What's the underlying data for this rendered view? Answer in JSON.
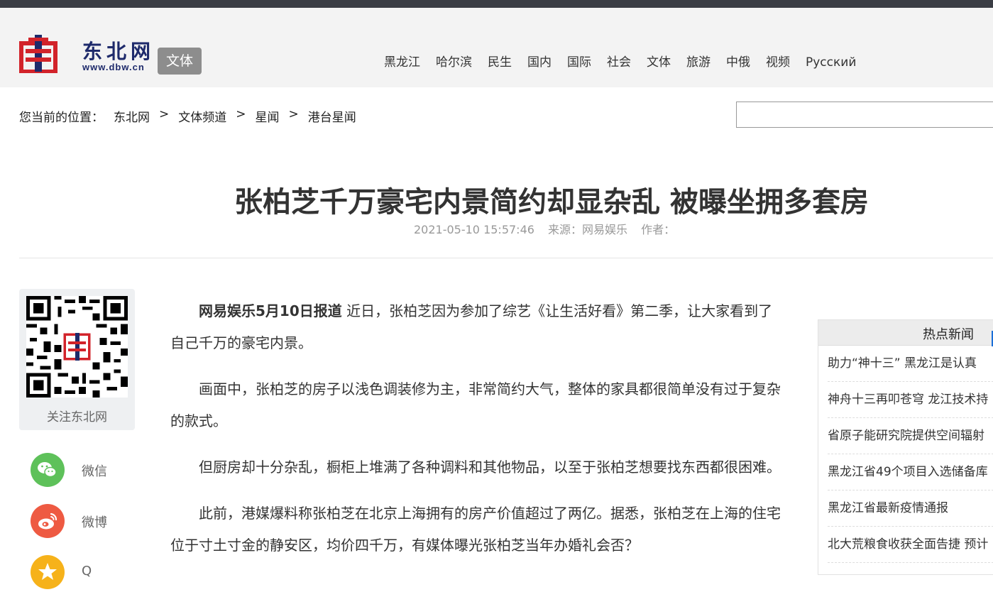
{
  "header": {
    "logo_text": "东北网",
    "logo_url": "www.dbw.cn",
    "channel_badge": "文体",
    "nav": [
      "黑龙江",
      "哈尔滨",
      "民生",
      "国内",
      "国际",
      "社会",
      "文体",
      "旅游",
      "中俄",
      "视频",
      "Русский"
    ]
  },
  "breadcrumb": {
    "prefix": "您当前的位置：",
    "items": [
      "东北网",
      "文体频道",
      "星闻",
      "港台星闻"
    ],
    "separator": ">"
  },
  "search": {
    "value": "",
    "placeholder": ""
  },
  "article": {
    "title": "张柏芝千万豪宅内景简约却显杂乱 被曝坐拥多套房",
    "datetime": "2021-05-10 15:57:46",
    "source": "来源：网易娱乐",
    "author": "作者：",
    "lead_bold": "网易娱乐5月10日报道",
    "p1_rest": " 近日，张柏芝因为参加了综艺《让生活好看》第二季，让大家看到了自己千万的豪宅内景。",
    "p2": "画面中，张柏芝的房子以浅色调装修为主，非常简约大气，整体的家具都很简单没有过于复杂的款式。",
    "p3": "但厨房却十分杂乱，橱柜上堆满了各种调料和其他物品，以至于张柏芝想要找东西都很困难。",
    "p4": "此前，港媒爆料称张柏芝在北京上海拥有的房产价值超过了两亿。据悉，张柏芝在上海的住宅位于寸土寸金的静安区，均价四千万，有媒体曝光张柏芝当年办婚礼会否？"
  },
  "share": {
    "qr_caption": "关注东北网",
    "wechat": "微信",
    "weibo": "微博",
    "third": "Q"
  },
  "hot_news": {
    "title": "热点新闻",
    "items": [
      "助力“神十三” 黑龙江是认真",
      "神舟十三再叩苍穹 龙江技术持",
      "省原子能研究院提供空间辐射",
      "黑龙江省49个项目入选储备库",
      "黑龙江省最新疫情通报",
      "北大荒粮食收获全面告捷 预计"
    ]
  },
  "colors": {
    "topbar": "#3a3d44",
    "header_bg": "#f3f3f3",
    "badge_bg": "#8d8d8d",
    "logo_red": "#d2232a",
    "logo_blue": "#1e2a6b",
    "wechat_green": "#5ec15a",
    "weibo_red": "#ee5a42",
    "third_yellow": "#f6b21a",
    "hot_accent": "#1b6fd8"
  }
}
